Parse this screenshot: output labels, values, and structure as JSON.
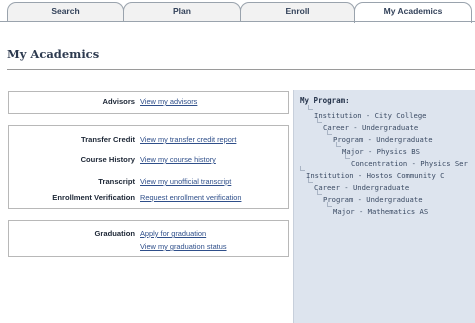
{
  "tabs": [
    {
      "label": "Search"
    },
    {
      "label": "Plan"
    },
    {
      "label": "Enroll"
    },
    {
      "label": "My Academics"
    }
  ],
  "page": {
    "title": "My Academics"
  },
  "groups": {
    "advisors": [
      {
        "label": "Advisors",
        "link": "View my advisors"
      }
    ],
    "records": [
      {
        "label": "Transfer Credit",
        "link": "View my transfer credit report"
      },
      {
        "label": "Course History",
        "link": "View my course history"
      },
      {
        "label": "Transcript",
        "link": "View my unofficial transcript"
      },
      {
        "label": "Enrollment Verification",
        "link": "Request enrollment verification"
      }
    ],
    "graduation": [
      {
        "label": "Graduation",
        "link": "Apply for graduation"
      },
      {
        "label": "",
        "link": "View my graduation status"
      }
    ]
  },
  "program": {
    "title": "My Program:",
    "tree": [
      {
        "text": "Institution - City College"
      },
      {
        "text": "Career - Undergraduate"
      },
      {
        "text": "Program - Undergraduate"
      },
      {
        "text": "Major - Physics BS"
      },
      {
        "text": "Concentration - Physics Ser"
      },
      {
        "text": "Institution - Hostos Community C"
      },
      {
        "text": "Career - Undergraduate"
      },
      {
        "text": "Program - Undergraduate"
      },
      {
        "text": "Major - Mathematics AS"
      }
    ]
  }
}
